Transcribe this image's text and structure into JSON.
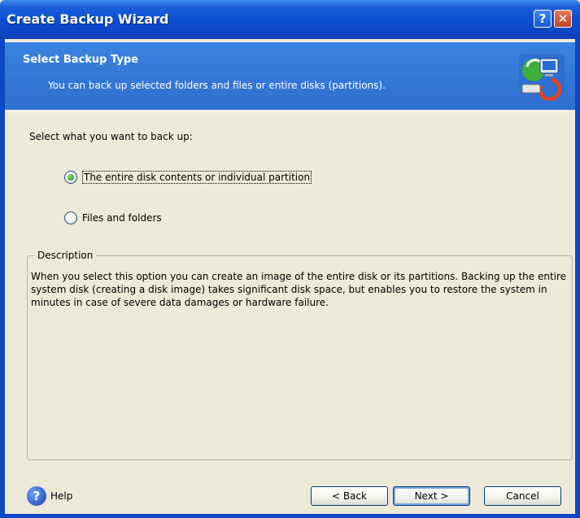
{
  "window": {
    "title": "Create Backup Wizard",
    "help_glyph": "?",
    "close_glyph": "✕"
  },
  "header": {
    "title": "Select Backup Type",
    "subtitle": "You can back up selected folders and files or entire disks (partitions).",
    "icon": "backup-wizard-icon"
  },
  "main": {
    "prompt": "Select what you want to back up:",
    "options": [
      {
        "label": "The entire disk contents or individual partition",
        "selected": true
      },
      {
        "label": "Files and folders",
        "selected": false
      }
    ],
    "description": {
      "legend": "Description",
      "text": "When you select this option you can create an image of the entire disk or its partitions. Backing up the entire system disk (creating a disk image) takes significant disk space, but enables you to restore the system in minutes in case of severe data damages or hardware failure."
    }
  },
  "footer": {
    "help_label": "Help",
    "back_label": "< Back",
    "next_label": "Next >",
    "cancel_label": "Cancel"
  },
  "colors": {
    "titlebar": "#0a4fd3",
    "header": "#3a83e0",
    "dialog_bg": "#ece9d8",
    "radio_selected": "#1f9a16"
  }
}
